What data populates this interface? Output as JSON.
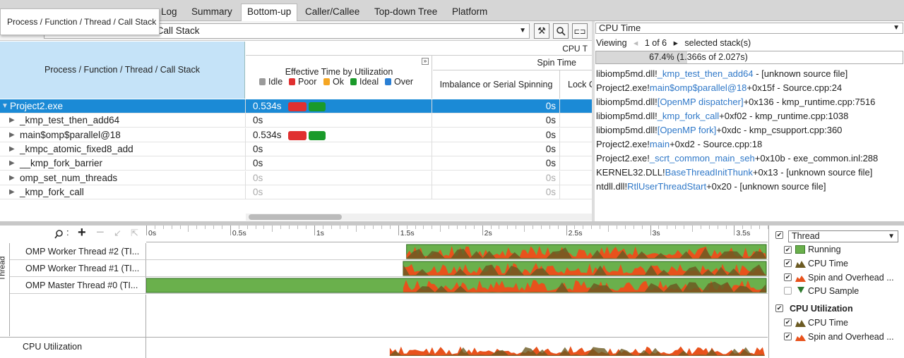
{
  "tabs": [
    "Log",
    "Summary",
    "Bottom-up",
    "Caller/Callee",
    "Top-down Tree",
    "Platform"
  ],
  "active_tab": "Bottom-up",
  "tooltip": "Process / Function / Thread / Call Stack",
  "grouping": {
    "value": "d / Call Stack"
  },
  "grid": {
    "header_left": "Process / Function / Thread / Call Stack",
    "header_cpu": "CPU T",
    "header_effective": "Effective Time by Utilization",
    "legend": [
      "Idle",
      "Poor",
      "Ok",
      "Ideal",
      "Over"
    ],
    "header_spin": "Spin Time",
    "header_imbalance": "Imbalance or Serial Spinning",
    "header_lock": "Lock C",
    "rows": [
      {
        "name": "Project2.exe",
        "eff": "0.534s",
        "spin": "0s",
        "bars": true,
        "dim": false
      },
      {
        "name": "_kmp_test_then_add64",
        "eff": "0s",
        "spin": "0s",
        "bars": false,
        "dim": false
      },
      {
        "name": "main$omp$parallel@18",
        "eff": "0.534s",
        "spin": "0s",
        "bars": true,
        "dim": false
      },
      {
        "name": "_kmpc_atomic_fixed8_add",
        "eff": "0s",
        "spin": "0s",
        "bars": false,
        "dim": false
      },
      {
        "name": "__kmp_fork_barrier",
        "eff": "0s",
        "spin": "0s",
        "bars": false,
        "dim": false
      },
      {
        "name": "omp_set_num_threads",
        "eff": "0s",
        "spin": "0s",
        "bars": false,
        "dim": true
      },
      {
        "name": "_kmp_fork_call",
        "eff": "0s",
        "spin": "0s",
        "bars": false,
        "dim": true
      }
    ]
  },
  "stack_panel": {
    "metric": "CPU Time",
    "viewing_label": "Viewing",
    "viewing_pos": "1 of 6",
    "viewing_suffix": "selected stack(s)",
    "percent_text": "67.4% (1.366s of 2.027s)",
    "percent": 0.674,
    "frames": [
      {
        "prefix": "libiomp5md.dll!",
        "link": "_kmp_test_then_add64",
        "suffix": " - [unknown source file]"
      },
      {
        "prefix": "Project2.exe!",
        "link": "main$omp$parallel@18",
        "suffix": "+0x15f - Source.cpp:24"
      },
      {
        "prefix": "libiomp5md.dll!",
        "link": "[OpenMP dispatcher]",
        "suffix": "+0x136 - kmp_runtime.cpp:7516"
      },
      {
        "prefix": "libiomp5md.dll!",
        "link": "_kmp_fork_call",
        "suffix": "+0xf02 - kmp_runtime.cpp:1038"
      },
      {
        "prefix": "libiomp5md.dll!",
        "link": "[OpenMP fork]",
        "suffix": "+0xdc - kmp_csupport.cpp:360"
      },
      {
        "prefix": "Project2.exe!",
        "link": "main",
        "suffix": "+0xd2 - Source.cpp:18"
      },
      {
        "prefix": "Project2.exe!",
        "link": "_scrt_common_main_seh",
        "suffix": "+0x10b - exe_common.inl:288"
      },
      {
        "prefix": "KERNEL32.DLL!",
        "link": "BaseThreadInitThunk",
        "suffix": "+0x13 - [unknown source file]"
      },
      {
        "prefix": "ntdll.dll!",
        "link": "RtlUserThreadStart",
        "suffix": "+0x20 - [unknown source file]"
      }
    ]
  },
  "timeline": {
    "ticks": [
      "0s",
      "0.5s",
      "1s",
      "1.5s",
      "2s",
      "2.5s",
      "3s",
      "3.5s"
    ],
    "thread_axis_label": "Thread",
    "threads": [
      {
        "name": "OMP Worker Thread #2 (TI...",
        "start_s": 1.55
      },
      {
        "name": "OMP Worker Thread #1 (TI...",
        "start_s": 1.53
      },
      {
        "name": "OMP Master Thread #0 (TI...",
        "start_s": 0.0
      }
    ],
    "cpu_util_label": "CPU Utilization",
    "end_s": 3.7,
    "legend_filter": "Thread",
    "legend_items": [
      "Running",
      "CPU Time",
      "Spin and Overhead ...",
      "CPU Sample"
    ],
    "legend_group2": "CPU Utilization",
    "legend_items2": [
      "CPU Time",
      "Spin and Overhead ..."
    ]
  },
  "colors": {
    "running": "#6ab04c",
    "cpu_time": "#6b5a22",
    "spin": "#e8521c",
    "selection": "#1b8ad6",
    "header_blue": "#c5e3f8",
    "link": "#2f78c8"
  }
}
